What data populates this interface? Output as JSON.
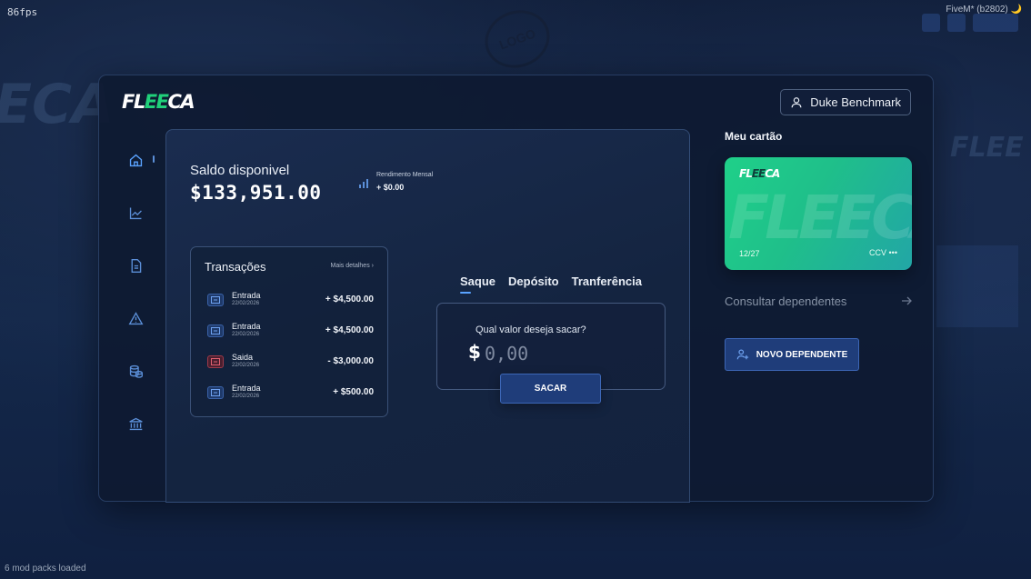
{
  "overlay": {
    "fps": "86fps",
    "client": "FiveM* (b2802) 🌙",
    "mod_packs": "6 mod packs loaded",
    "stamp": "LOGO"
  },
  "brand": {
    "prefix": "FL",
    "highlight": "EE",
    "suffix": "CA"
  },
  "user": {
    "name": "Duke Benchmark",
    "icon": "user-icon"
  },
  "nav": [
    {
      "id": "home",
      "icon": "home-icon",
      "active": true
    },
    {
      "id": "chart",
      "icon": "trending-up-icon"
    },
    {
      "id": "document",
      "icon": "document-icon"
    },
    {
      "id": "alert",
      "icon": "warning-icon"
    },
    {
      "id": "coins",
      "icon": "coins-icon"
    },
    {
      "id": "bank",
      "icon": "bank-icon"
    }
  ],
  "balance": {
    "label": "Saldo disponivel",
    "value": "$133,951.00",
    "yield_label": "Rendimento Mensal",
    "yield_value": "+ $0.00"
  },
  "transactions": {
    "title": "Transações",
    "more_label": "Mais detalhes",
    "items": [
      {
        "type": "Entrada",
        "date": "22/02/2026",
        "amount": "+ $4,500.00",
        "direction": "in"
      },
      {
        "type": "Entrada",
        "date": "22/02/2026",
        "amount": "+ $4,500.00",
        "direction": "in"
      },
      {
        "type": "Saida",
        "date": "22/02/2026",
        "amount": "- $3,000.00",
        "direction": "out"
      },
      {
        "type": "Entrada",
        "date": "22/02/2026",
        "amount": "+ $500.00",
        "direction": "in"
      }
    ]
  },
  "operations": {
    "tabs": [
      "Saque",
      "Depósito",
      "Tranferência"
    ],
    "active_tab": "Saque",
    "question": "Qual valor deseja sacar?",
    "currency": "$",
    "amount_placeholder": "0,00",
    "submit_label": "SACAR"
  },
  "card": {
    "title": "Meu cartão",
    "brand_prefix": "FL",
    "brand_highlight": "EE",
    "brand_suffix": "CA",
    "watermark": "FLEECA",
    "expiry": "12/27",
    "ccv": "CCV •••"
  },
  "dependents": {
    "link_label": "Consultar dependentes",
    "button_label": "NOVO DEPENDENTE"
  },
  "colors": {
    "accent": "#5aa3ff",
    "brand_green": "#20d07a",
    "button_bg": "#1f3d7a",
    "outflow": "#a03a4a"
  }
}
